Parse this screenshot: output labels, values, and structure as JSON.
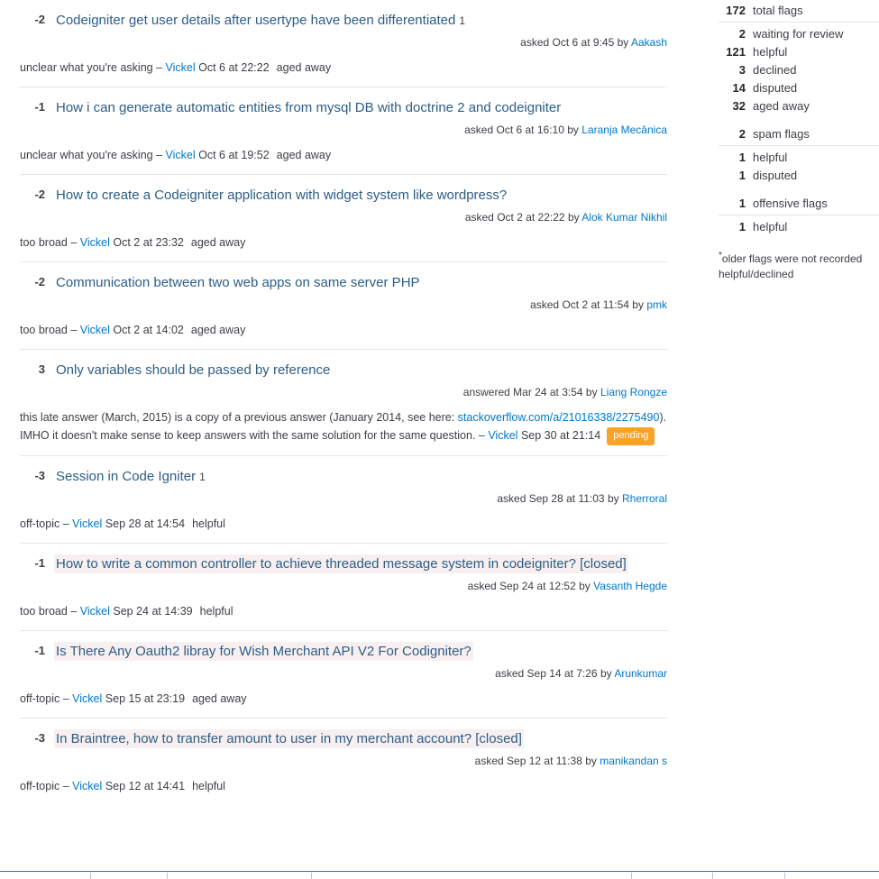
{
  "flags": [
    {
      "score": "-2",
      "title": "Codeigniter get user details after usertype have been differentiated",
      "answer_count": "1",
      "highlight": false,
      "action": "asked",
      "date": "Oct 6 at 9:45",
      "by": "by",
      "user": "Aakash",
      "reason": "unclear what you're asking",
      "dash": "–",
      "flagger": "Vickel",
      "flag_date": "Oct 6 at 22:22",
      "outcome": "aged away"
    },
    {
      "score": "-1",
      "title": "How i can generate automatic entities from mysql DB with doctrine 2 and codeigniter",
      "answer_count": "",
      "highlight": false,
      "action": "asked",
      "date": "Oct 6 at 16:10",
      "by": "by",
      "user": "Laranja Mecânica",
      "reason": "unclear what you're asking",
      "dash": "–",
      "flagger": "Vickel",
      "flag_date": "Oct 6 at 19:52",
      "outcome": "aged away"
    },
    {
      "score": "-2",
      "title": "How to create a Codeigniter application with widget system like wordpress?",
      "answer_count": "",
      "highlight": false,
      "action": "asked",
      "date": "Oct 2 at 22:22",
      "by": "by",
      "user": "Alok Kumar Nikhil",
      "reason": "too broad",
      "dash": "–",
      "flagger": "Vickel",
      "flag_date": "Oct 2 at 23:32",
      "outcome": "aged away"
    },
    {
      "score": "-2",
      "title": "Communication between two web apps on same server PHP",
      "answer_count": "",
      "highlight": false,
      "action": "asked",
      "date": "Oct 2 at 11:54",
      "by": "by",
      "user": "pmk",
      "reason": "too broad",
      "dash": "–",
      "flagger": "Vickel",
      "flag_date": "Oct 2 at 14:02",
      "outcome": "aged away"
    },
    {
      "score": "3",
      "title": "Only variables should be passed by reference",
      "answer_count": "",
      "highlight": false,
      "action": "answered",
      "date": "Mar 24 at 3:54",
      "by": "by",
      "user": "Liang Rongze",
      "comment_rich": true,
      "comment_part1": "this late answer (March, 2015) is a copy of a previous answer (January 2014, see here: ",
      "comment_link": "stackoverflow.com/a/21016338/2275490",
      "comment_part2": "). IMHO it doesn't make sense to keep answers with the same solution for the same question. ",
      "dash": "–",
      "flagger": "Vickel",
      "flag_date": "Sep 30 at 21:14",
      "outcome": "",
      "badge": "pending"
    },
    {
      "score": "-3",
      "title": "Session in Code Igniter",
      "answer_count": "1",
      "highlight": false,
      "action": "asked",
      "date": "Sep 28 at 11:03",
      "by": "by",
      "user": "Rherroral",
      "reason": "off-topic",
      "dash": "–",
      "flagger": "Vickel",
      "flag_date": "Sep 28 at 14:54",
      "outcome": "helpful"
    },
    {
      "score": "-1",
      "title": "How to write a common controller to achieve threaded message system in codeigniter? [closed]",
      "answer_count": "",
      "highlight": true,
      "action": "asked",
      "date": "Sep 24 at 12:52",
      "by": "by",
      "user": "Vasanth Hegde",
      "reason": "too broad",
      "dash": "–",
      "flagger": "Vickel",
      "flag_date": "Sep 24 at 14:39",
      "outcome": "helpful"
    },
    {
      "score": "-1",
      "title": "Is There Any Oauth2 libray for Wish Merchant API V2 For Codigniter?",
      "answer_count": "",
      "highlight": true,
      "action": "asked",
      "date": "Sep 14 at 7:26",
      "by": "by",
      "user": "Arunkumar",
      "reason": "off-topic",
      "dash": "–",
      "flagger": "Vickel",
      "flag_date": "Sep 15 at 23:19",
      "outcome": "aged away"
    },
    {
      "score": "-3",
      "title": "In Braintree, how to transfer amount to user in my merchant account? [closed]",
      "answer_count": "",
      "highlight": true,
      "action": "asked",
      "date": "Sep 12 at 11:38",
      "by": "by",
      "user": "manikandan s",
      "reason": "off-topic",
      "dash": "–",
      "flagger": "Vickel",
      "flag_date": "Sep 12 at 14:41",
      "outcome": "helpful"
    }
  ],
  "summary": {
    "groups": [
      {
        "header": {
          "count": "172",
          "label": "total flags"
        },
        "rows": [
          {
            "count": "2",
            "label": "waiting for review"
          },
          {
            "count": "121",
            "label": "helpful"
          },
          {
            "count": "3",
            "label": "declined"
          },
          {
            "count": "14",
            "label": "disputed"
          },
          {
            "count": "32",
            "label": "aged away"
          }
        ]
      },
      {
        "header": {
          "count": "2",
          "label": "spam flags"
        },
        "rows": [
          {
            "count": "1",
            "label": "helpful"
          },
          {
            "count": "1",
            "label": "disputed"
          }
        ]
      },
      {
        "header": {
          "count": "1",
          "label": "offensive flags"
        },
        "rows": [
          {
            "count": "1",
            "label": "helpful"
          }
        ]
      }
    ],
    "footnote_star": "*",
    "footnote": "older flags were not recorded helpful/declined"
  },
  "colors": {
    "link": "#0077cc",
    "title_link": "#2c5d86",
    "text": "#3b4045",
    "highlight_bg": "#f8f0f0",
    "pending_badge": "#faa225",
    "separator": "#e4e6e8"
  }
}
